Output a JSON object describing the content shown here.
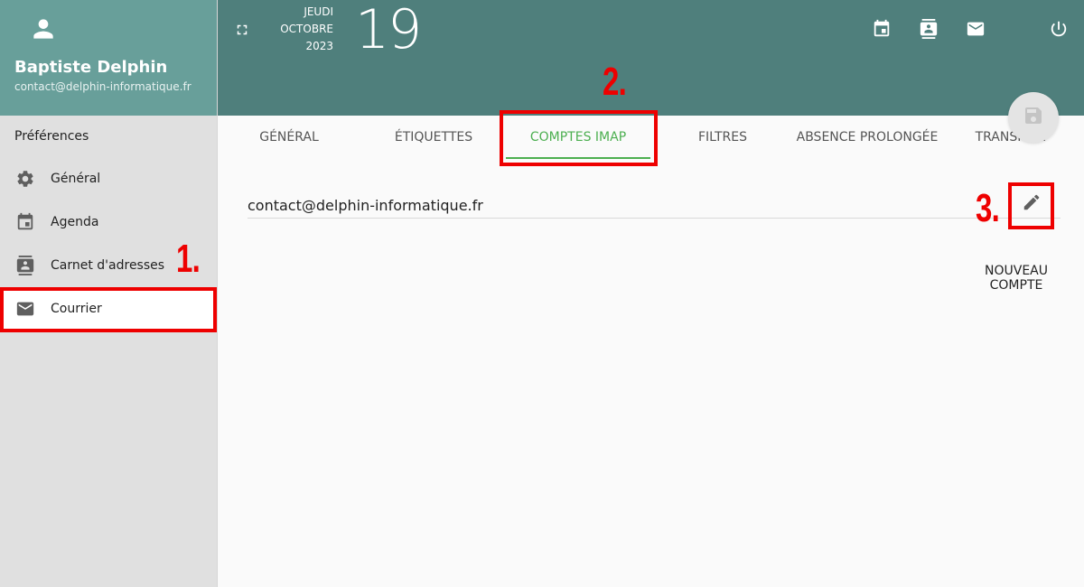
{
  "user": {
    "name": "Baptiste Delphin",
    "email": "contact@delphin-informatique.fr",
    "avatar_icon": "person-icon"
  },
  "sidebar": {
    "heading": "Préférences",
    "items": [
      {
        "label": "Général",
        "icon": "gear-icon",
        "active": false
      },
      {
        "label": "Agenda",
        "icon": "calendar-icon",
        "active": false
      },
      {
        "label": "Carnet d'adresses",
        "icon": "contacts-icon",
        "active": false
      },
      {
        "label": "Courrier",
        "icon": "mail-icon",
        "active": true
      }
    ]
  },
  "header": {
    "weekday": "JEUDI",
    "month": "OCTOBRE",
    "year": "2023",
    "day": "19",
    "icons": [
      "fullscreen-icon",
      "calendar-icon",
      "contacts-icon",
      "mail-icon",
      "power-icon"
    ]
  },
  "tabs": [
    {
      "label": "GÉNÉRAL",
      "active": false
    },
    {
      "label": "ÉTIQUETTES",
      "active": false
    },
    {
      "label": "COMPTES IMAP",
      "active": true
    },
    {
      "label": "FILTRES",
      "active": false
    },
    {
      "label": "ABSENCE PROLONGÉE",
      "active": false
    },
    {
      "label": "TRANSFERT",
      "active": false
    }
  ],
  "accounts": [
    {
      "email": "contact@delphin-informatique.fr"
    }
  ],
  "new_account_label": "NOUVEAU COMPTE",
  "annotations": {
    "step1": "1.",
    "step2": "2.",
    "step3": "3."
  },
  "colors": {
    "header_bg": "#4f7f7c",
    "user_panel_bg": "#689f9a",
    "accent": "#4caf50",
    "annotation_red": "#ee0000"
  }
}
